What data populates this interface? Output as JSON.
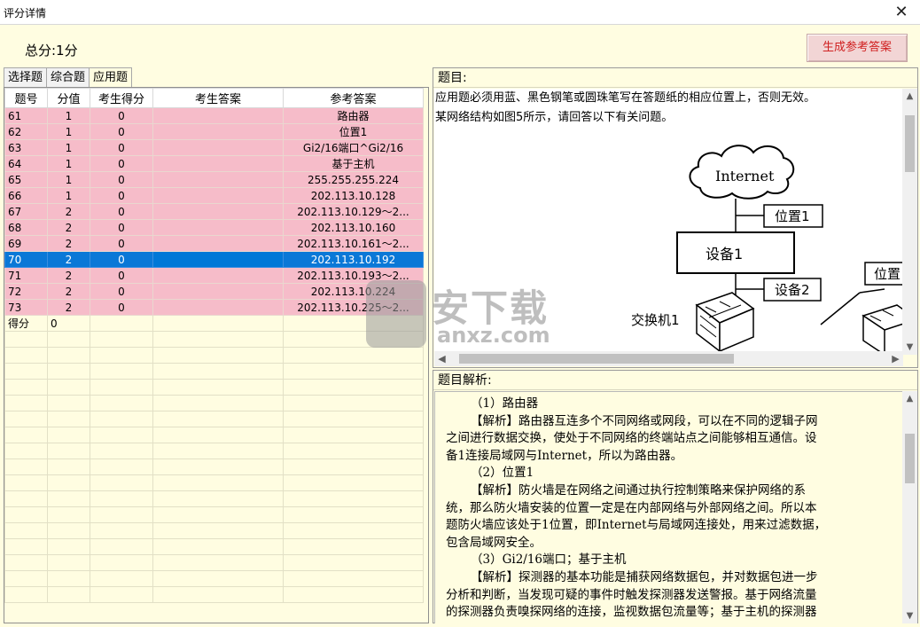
{
  "window": {
    "title": "评分详情",
    "close_glyph": "✕"
  },
  "summary": {
    "total": "总分:1分",
    "generate_button": "生成参考答案"
  },
  "tabs": [
    {
      "label": "选择题",
      "active": false
    },
    {
      "label": "综合题",
      "active": false
    },
    {
      "label": "应用题",
      "active": true
    }
  ],
  "grid": {
    "headers": [
      "题号",
      "分值",
      "考生得分",
      "考生答案",
      "参考答案"
    ],
    "rows": [
      {
        "no": "61",
        "points": "1",
        "score": "0",
        "answer": "",
        "ref": "路由器",
        "state": "wrong"
      },
      {
        "no": "62",
        "points": "1",
        "score": "0",
        "answer": "",
        "ref": "位置1",
        "state": "wrong"
      },
      {
        "no": "63",
        "points": "1",
        "score": "0",
        "answer": "",
        "ref": "Gi2/16端口^Gi2/16",
        "state": "wrong"
      },
      {
        "no": "64",
        "points": "1",
        "score": "0",
        "answer": "",
        "ref": "基于主机",
        "state": "wrong"
      },
      {
        "no": "65",
        "points": "1",
        "score": "0",
        "answer": "",
        "ref": "255.255.255.224",
        "state": "wrong"
      },
      {
        "no": "66",
        "points": "1",
        "score": "0",
        "answer": "",
        "ref": "202.113.10.128",
        "state": "wrong"
      },
      {
        "no": "67",
        "points": "2",
        "score": "0",
        "answer": "",
        "ref": "202.113.10.129～2...",
        "state": "wrong"
      },
      {
        "no": "68",
        "points": "2",
        "score": "0",
        "answer": "",
        "ref": "202.113.10.160",
        "state": "wrong"
      },
      {
        "no": "69",
        "points": "2",
        "score": "0",
        "answer": "",
        "ref": "202.113.10.161～2...",
        "state": "wrong"
      },
      {
        "no": "70",
        "points": "2",
        "score": "0",
        "answer": "",
        "ref": "202.113.10.192",
        "state": "selected"
      },
      {
        "no": "71",
        "points": "2",
        "score": "0",
        "answer": "",
        "ref": "202.113.10.193～2...",
        "state": "wrong"
      },
      {
        "no": "72",
        "points": "2",
        "score": "0",
        "answer": "",
        "ref": "202.113.10.224",
        "state": "wrong"
      },
      {
        "no": "73",
        "points": "2",
        "score": "0",
        "answer": "",
        "ref": "202.113.10.225～2...",
        "state": "wrong"
      },
      {
        "no": "得分",
        "points": "0",
        "score": "",
        "answer": "",
        "ref": "",
        "state": "summary"
      }
    ],
    "blank_rows": 17
  },
  "question": {
    "header": "题目:",
    "lines": [
      "应用题必须用蓝、黑色钢笔或圆珠笔写在答题纸的相应位置上，否则无效。",
      "某网络结构如图5所示，请回答以下有关问题。"
    ],
    "diagram": {
      "internet": "Internet",
      "pos1": "位置1",
      "device1": "设备1",
      "device2": "设备2",
      "switch1": "交换机1",
      "pos_right": "位置"
    }
  },
  "analysis": {
    "header": "题目解析:",
    "paragraphs": [
      {
        "style": "ind",
        "text": "（1）路由器"
      },
      {
        "style": "ind",
        "text": "【解析】路由器互连多个不同网络或网段，可以在不同的逻辑子网"
      },
      {
        "style": "plain",
        "text": "之间进行数据交换，使处于不同网络的终端站点之间能够相互通信。设"
      },
      {
        "style": "plain",
        "text": "备1连接局域网与Internet，所以为路由器。"
      },
      {
        "style": "ind",
        "text": "（2）位置1"
      },
      {
        "style": "ind",
        "text": "【解析】防火墙是在网络之间通过执行控制策略来保护网络的系"
      },
      {
        "style": "plain",
        "text": "统，那么防火墙安装的位置一定是在内部网络与外部网络之间。所以本"
      },
      {
        "style": "plain",
        "text": "题防火墙应该处于1位置，即Internet与局域网连接处，用来过滤数据，"
      },
      {
        "style": "plain",
        "text": "包含局域网安全。"
      },
      {
        "style": "ind",
        "text": "（3）Gi2/16端口；基于主机"
      },
      {
        "style": "ind",
        "text": "【解析】探测器的基本功能是捕获网络数据包，并对数据包进一步"
      },
      {
        "style": "plain",
        "text": "分析和判断，当发现可疑的事件时触发探测器发送警报。基于网络流量"
      },
      {
        "style": "plain",
        "text": "的探测器负责嗅探网络的连接，监视数据包流量等；基于主机的探测器"
      }
    ]
  },
  "watermark": {
    "main": "安下载",
    "sub": "anxz.com"
  },
  "colors": {
    "wrong_row": "#f6bcc9",
    "selected_row": "#0a78d7",
    "panel_bg": "#fffde1",
    "button_text": "#d02020"
  }
}
